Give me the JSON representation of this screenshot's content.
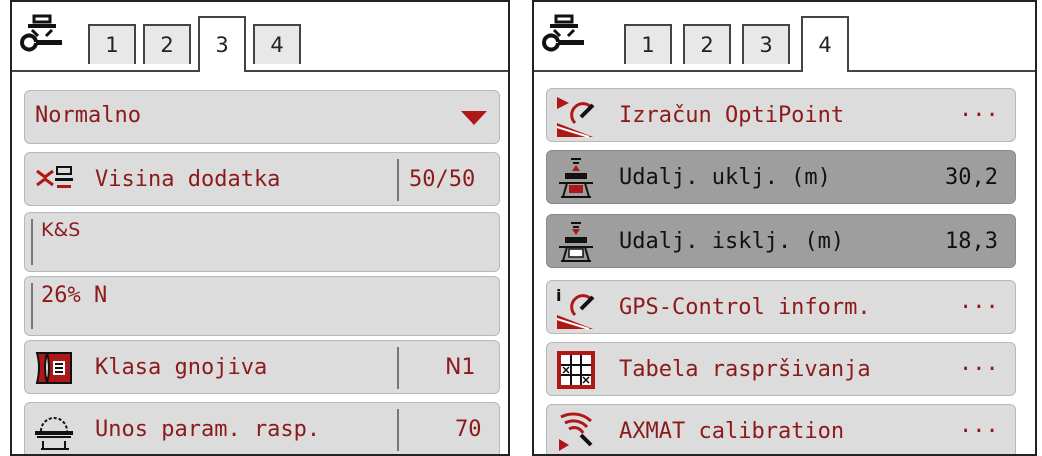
{
  "left_panel": {
    "tabs": [
      "1",
      "2",
      "3",
      "4"
    ],
    "active_tab": "3",
    "mode_dropdown": {
      "value": "Normalno"
    },
    "rows": {
      "visina": {
        "label": "Visina dodatka",
        "value": "50/50"
      },
      "fertilizer_name": {
        "value": "K&S"
      },
      "fertilizer_content": {
        "value": "26% N"
      },
      "klasa": {
        "label": "Klasa gnojiva",
        "value": "N1"
      },
      "unos": {
        "label": "Unos param. rasp.",
        "value": "70"
      }
    }
  },
  "right_panel": {
    "tabs": [
      "1",
      "2",
      "3",
      "4"
    ],
    "active_tab": "4",
    "rows": {
      "optipoint": {
        "label": "Izračun OptiPoint",
        "value": "···"
      },
      "ukljucenje": {
        "label": "Udalj. uklj. (m)",
        "value": "30,2"
      },
      "iskljucenje": {
        "label": "Udalj. isklj. (m)",
        "value": "18,3"
      },
      "gps_info": {
        "label": "GPS-Control inform.",
        "value": "···"
      },
      "tabela": {
        "label": "Tabela raspršivanja",
        "value": "···"
      },
      "axmat": {
        "label": "AXMAT calibration",
        "value": "···"
      }
    }
  },
  "colors": {
    "text_red": "#8b1a1a",
    "row_bg": "#dcdcdc",
    "row_selected": "#9e9e9e",
    "arrow_red": "#b01818"
  }
}
